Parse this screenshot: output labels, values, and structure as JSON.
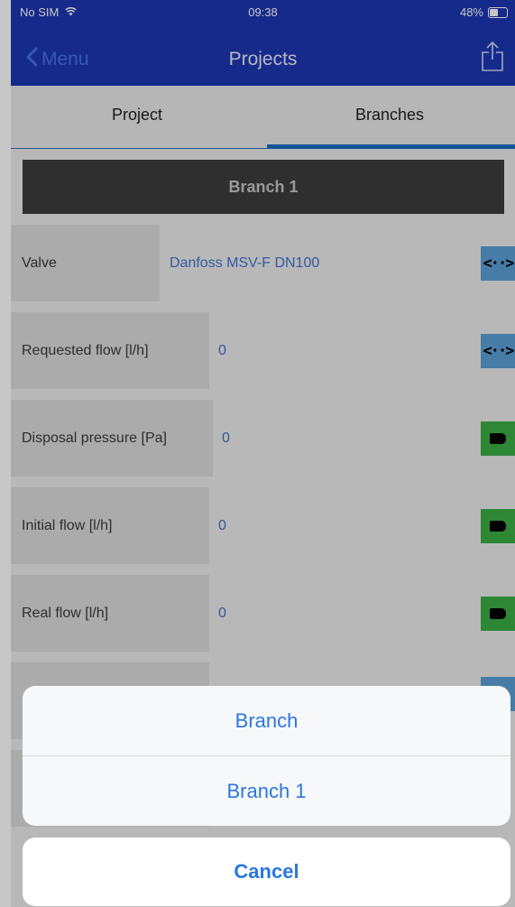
{
  "status_bar": {
    "carrier": "No SIM",
    "time": "09:38",
    "battery": "48%"
  },
  "nav": {
    "back_label": "Menu",
    "title": "Projects"
  },
  "tabs": [
    {
      "label": "Project",
      "selected": false
    },
    {
      "label": "Branches",
      "selected": true
    }
  ],
  "branch": {
    "header": "Branch 1",
    "rows": [
      {
        "label": "Valve",
        "value": "Danfoss MSV-F  DN100",
        "button": "select-arrows"
      },
      {
        "label": "Requested flow [l/h]",
        "value": "0",
        "button": "select-arrows"
      },
      {
        "label": "Disposal pressure [Pa]",
        "value": "0",
        "button": "tag"
      },
      {
        "label": "Initial flow [l/h]",
        "value": "0",
        "button": "tag"
      },
      {
        "label": "Real flow [l/h]",
        "value": "0",
        "button": "tag"
      }
    ]
  },
  "action_sheet": {
    "options": [
      "Branch",
      "Branch 1"
    ],
    "cancel_label": "Cancel"
  },
  "colors": {
    "nav_bar": "#1b36b2",
    "accent_blue": "#2a77dd",
    "button_blue": "#5c9fd6",
    "button_green": "#3bae45",
    "header_dark": "#3d3d3d"
  }
}
